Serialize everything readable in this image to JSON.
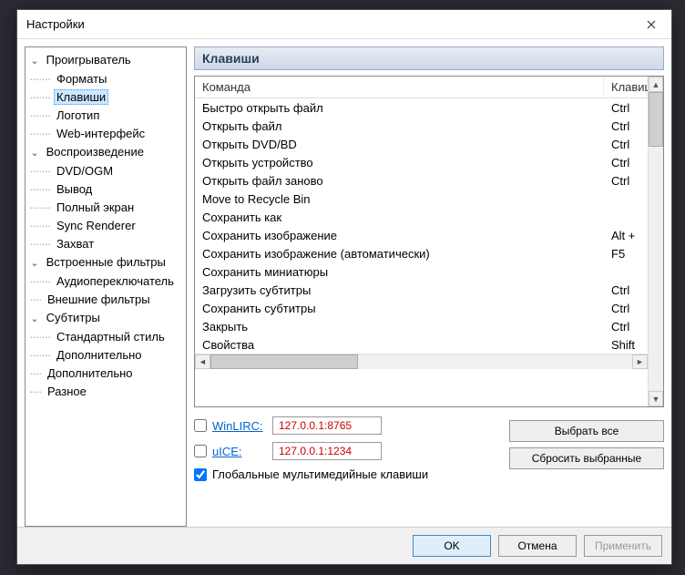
{
  "window": {
    "title": "Настройки"
  },
  "tree": [
    {
      "label": "Проигрыватель",
      "depth": 0,
      "expanded": true
    },
    {
      "label": "Форматы",
      "depth": 1
    },
    {
      "label": "Клавиши",
      "depth": 1,
      "selected": true
    },
    {
      "label": "Логотип",
      "depth": 1
    },
    {
      "label": "Web-интерфейс",
      "depth": 1
    },
    {
      "label": "Воспроизведение",
      "depth": 0,
      "expanded": true
    },
    {
      "label": "DVD/OGM",
      "depth": 1
    },
    {
      "label": "Вывод",
      "depth": 1
    },
    {
      "label": "Полный экран",
      "depth": 1
    },
    {
      "label": "Sync Renderer",
      "depth": 1
    },
    {
      "label": "Захват",
      "depth": 1
    },
    {
      "label": "Встроенные фильтры",
      "depth": 0,
      "expanded": true
    },
    {
      "label": "Аудиопереключатель",
      "depth": 1
    },
    {
      "label": "Внешние фильтры",
      "depth": 0
    },
    {
      "label": "Субтитры",
      "depth": 0,
      "expanded": true
    },
    {
      "label": "Стандартный стиль",
      "depth": 1
    },
    {
      "label": "Дополнительно",
      "depth": 1
    },
    {
      "label": "Дополнительно",
      "depth": 0
    },
    {
      "label": "Разное",
      "depth": 0
    }
  ],
  "section": {
    "title": "Клавиши"
  },
  "columns": {
    "command": "Команда",
    "key": "Клавиши"
  },
  "rows": [
    {
      "cmd": "Быстро открыть файл",
      "key": "Ctrl"
    },
    {
      "cmd": "Открыть файл",
      "key": "Ctrl"
    },
    {
      "cmd": "Открыть DVD/BD",
      "key": "Ctrl"
    },
    {
      "cmd": "Открыть устройство",
      "key": "Ctrl"
    },
    {
      "cmd": "Открыть файл заново",
      "key": "Ctrl"
    },
    {
      "cmd": "Move to Recycle Bin",
      "key": ""
    },
    {
      "cmd": "Сохранить как",
      "key": ""
    },
    {
      "cmd": "Сохранить изображение",
      "key": "Alt +"
    },
    {
      "cmd": "Сохранить изображение (автоматически)",
      "key": "F5"
    },
    {
      "cmd": "Сохранить миниатюры",
      "key": ""
    },
    {
      "cmd": "Загрузить субтитры",
      "key": "Ctrl"
    },
    {
      "cmd": "Сохранить субтитры",
      "key": "Ctrl"
    },
    {
      "cmd": "Закрыть",
      "key": "Ctrl"
    },
    {
      "cmd": "Свойства",
      "key": "Shift"
    }
  ],
  "remote": {
    "winlirc": {
      "label": "WinLIRC:",
      "addr": "127.0.0.1:8765",
      "checked": false
    },
    "uice": {
      "label": "uICE:",
      "addr": "127.0.0.1:1234",
      "checked": false
    },
    "global": {
      "label": "Глобальные мультимедийные клавиши",
      "checked": true
    }
  },
  "buttons": {
    "select_all": "Выбрать все",
    "reset_sel": "Сбросить выбранные",
    "ok": "OK",
    "cancel": "Отмена",
    "apply": "Применить"
  }
}
